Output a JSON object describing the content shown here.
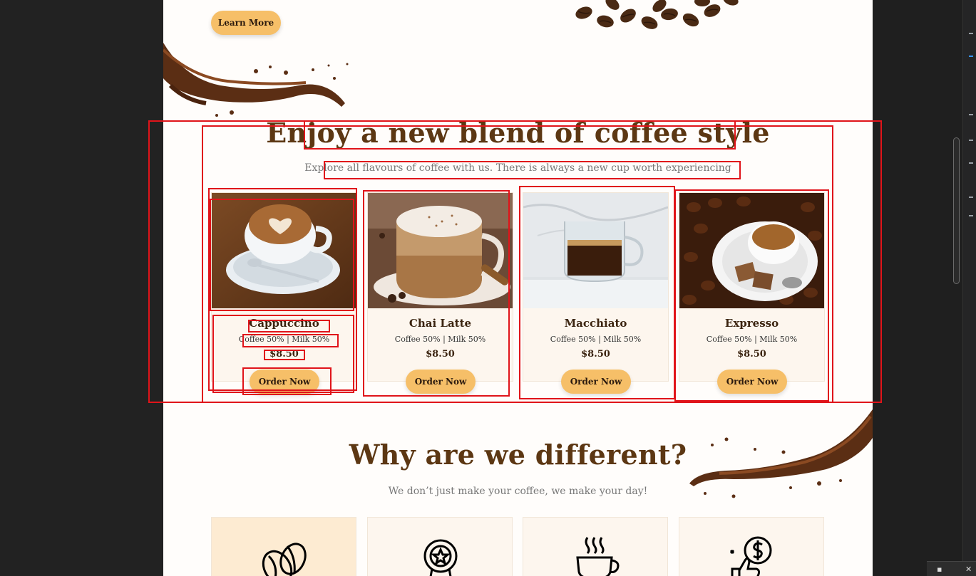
{
  "hero": {
    "learn_more_label": "Learn More"
  },
  "blend_section": {
    "title": "Enjoy a new blend of coffee style",
    "subtitle": "Explore all flavours of coffee with us. There is always a new cup worth experiencing",
    "cards": [
      {
        "name": "Cappuccino",
        "desc": "Coffee 50% | Milk 50%",
        "price": "$8.50",
        "button": "Order Now",
        "image": "cappuccino-latte-art"
      },
      {
        "name": "Chai Latte",
        "desc": "Coffee 50% | Milk 50%",
        "price": "$8.50",
        "button": "Order Now",
        "image": "chai-latte-cinnamon"
      },
      {
        "name": "Macchiato",
        "desc": "Coffee 50% | Milk 50%",
        "price": "$8.50",
        "button": "Order Now",
        "image": "macchiato-glass"
      },
      {
        "name": "Expresso",
        "desc": "Coffee 50% | Milk 50%",
        "price": "$8.50",
        "button": "Order Now",
        "image": "espresso-on-beans"
      }
    ]
  },
  "why_section": {
    "title": "Why are we different?",
    "subtitle": "We don’t just make your coffee, we make your day!",
    "features": [
      {
        "icon": "coffee-bean-icon"
      },
      {
        "icon": "award-badge-icon"
      },
      {
        "icon": "coffee-cup-icon"
      },
      {
        "icon": "thumbs-up-money-icon"
      }
    ]
  },
  "colors": {
    "accent": "#f6bf68",
    "heading": "#5c3713",
    "annotation": "#e0141a"
  }
}
